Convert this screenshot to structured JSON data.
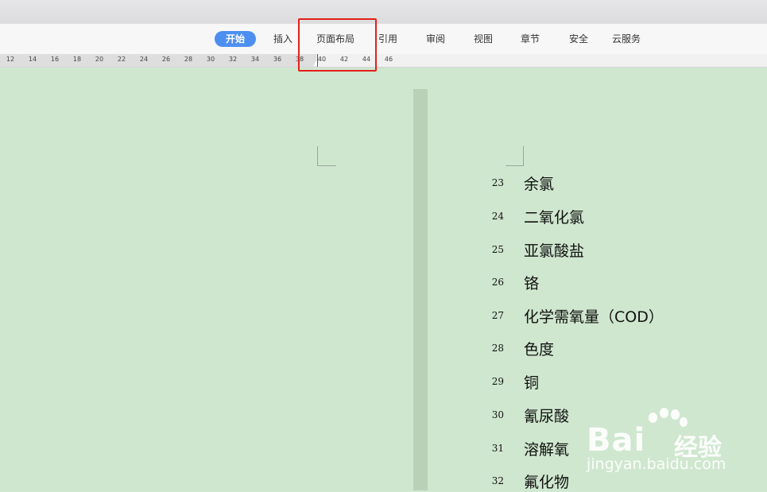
{
  "menu": {
    "tabs": [
      {
        "label": "开始",
        "active": true
      },
      {
        "label": "插入"
      },
      {
        "label": "页面布局",
        "highlighted": true
      },
      {
        "label": "引用"
      },
      {
        "label": "审阅"
      },
      {
        "label": "视图"
      },
      {
        "label": "章节"
      },
      {
        "label": "安全"
      },
      {
        "label": "云服务"
      }
    ]
  },
  "ruler": {
    "ticks": [
      "12",
      "14",
      "16",
      "18",
      "20",
      "22",
      "24",
      "26",
      "28",
      "30",
      "32",
      "34",
      "36",
      "38",
      "40",
      "42",
      "44",
      "46"
    ]
  },
  "document": {
    "items": [
      {
        "num": "23",
        "name": "余氯"
      },
      {
        "num": "24",
        "name": "二氧化氯"
      },
      {
        "num": "25",
        "name": "亚氯酸盐"
      },
      {
        "num": "26",
        "name": "铬"
      },
      {
        "num": "27",
        "name": "化学需氧量（COD）"
      },
      {
        "num": "28",
        "name": "色度"
      },
      {
        "num": "29",
        "name": "铜"
      },
      {
        "num": "30",
        "name": "氰尿酸"
      },
      {
        "num": "31",
        "name": "溶解氧"
      },
      {
        "num": "32",
        "name": "氟化物"
      }
    ]
  },
  "watermark": {
    "brand": "Bai",
    "brand_suffix": "经验",
    "url": "jingyan.baidu.com"
  },
  "colors": {
    "accent": "#4d8ff0",
    "highlight_box": "#e4201a",
    "page_background": "#cfe7cf"
  }
}
